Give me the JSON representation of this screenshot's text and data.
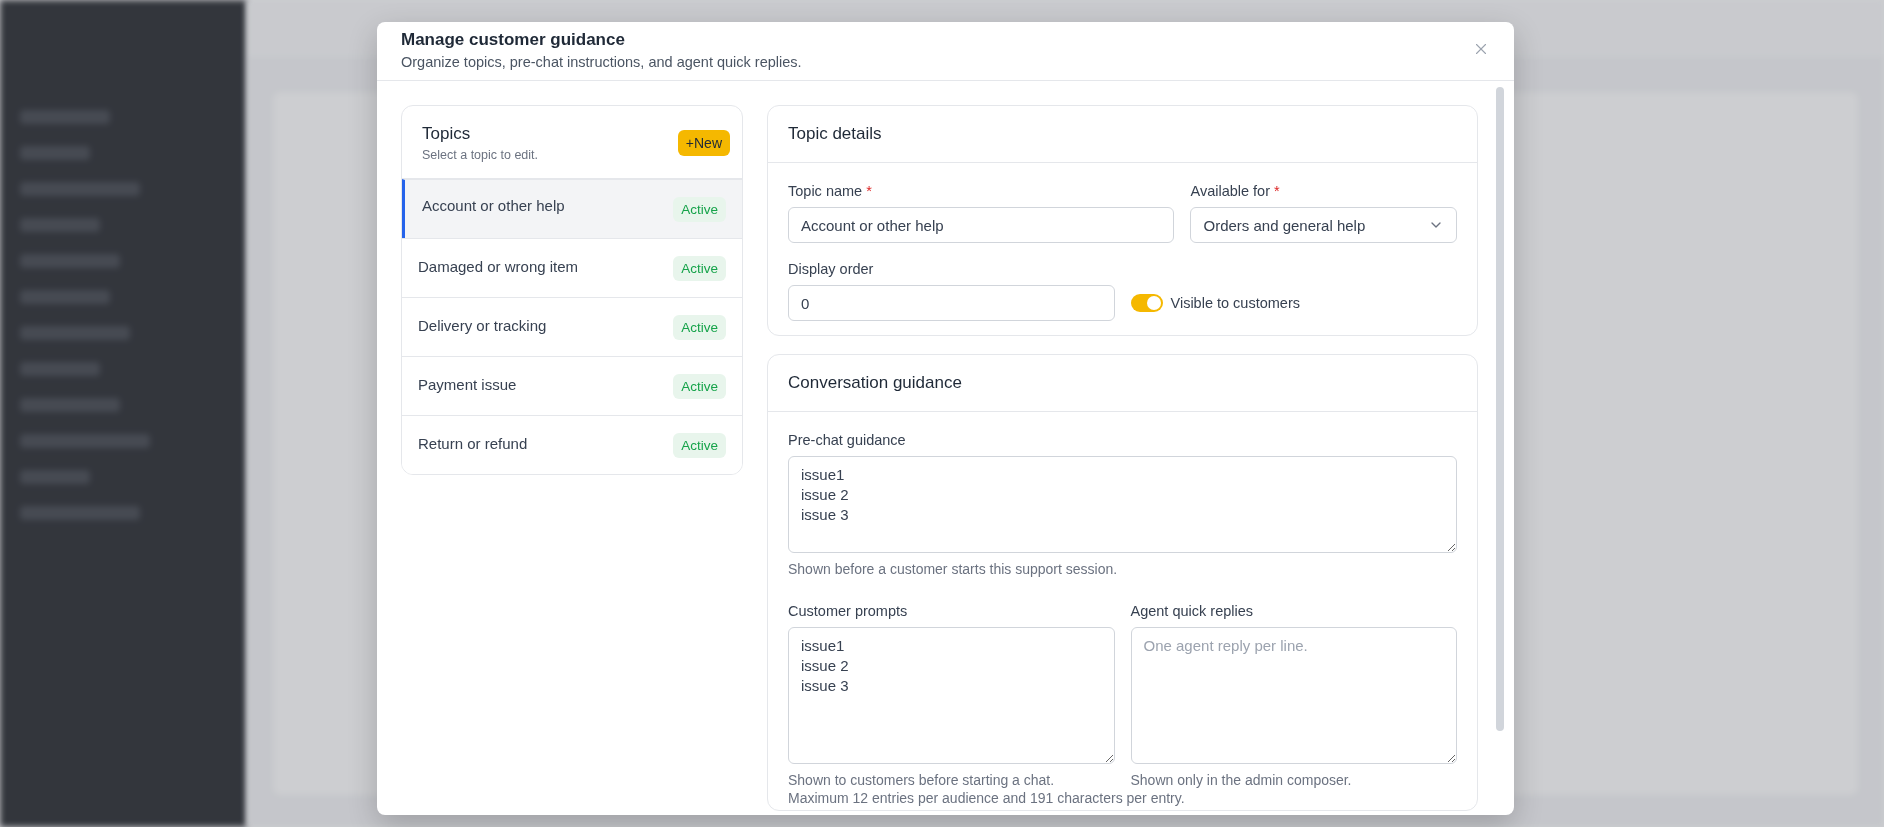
{
  "modal": {
    "title": "Manage customer guidance",
    "subtitle": "Organize topics, pre-chat instructions, and agent quick replies."
  },
  "topics": {
    "title": "Topics",
    "hint": "Select a topic to edit.",
    "new_button": "+New",
    "items": [
      {
        "label": "Account or other help",
        "status": "Active",
        "selected": true
      },
      {
        "label": "Damaged or wrong item",
        "status": "Active",
        "selected": false
      },
      {
        "label": "Delivery or tracking",
        "status": "Active",
        "selected": false
      },
      {
        "label": "Payment issue",
        "status": "Active",
        "selected": false
      },
      {
        "label": "Return or refund",
        "status": "Active",
        "selected": false
      }
    ]
  },
  "topic_details": {
    "title": "Topic details",
    "topic_name": {
      "label": "Topic name",
      "required_mark": "*",
      "value": "Account or other help"
    },
    "available_for": {
      "label": "Available for",
      "required_mark": "*",
      "value": "Orders and general help"
    },
    "display_order": {
      "label": "Display order",
      "value": "0"
    },
    "visible_toggle": {
      "label": "Visible to customers",
      "on": true
    }
  },
  "guidance": {
    "title": "Conversation guidance",
    "pre_chat": {
      "label": "Pre-chat guidance",
      "value": "issue1\nissue 2\nissue 3",
      "help": "Shown before a customer starts this support session."
    },
    "customer_prompts": {
      "label": "Customer prompts",
      "value": "issue1\nissue 2\nissue 3",
      "help": "Shown to customers before starting a chat."
    },
    "agent_quick_replies": {
      "label": "Agent quick replies",
      "placeholder": "One agent reply per line.",
      "help": "Shown only in the admin composer."
    },
    "limit_note": "Maximum 12 entries per audience and 191 characters per entry."
  }
}
